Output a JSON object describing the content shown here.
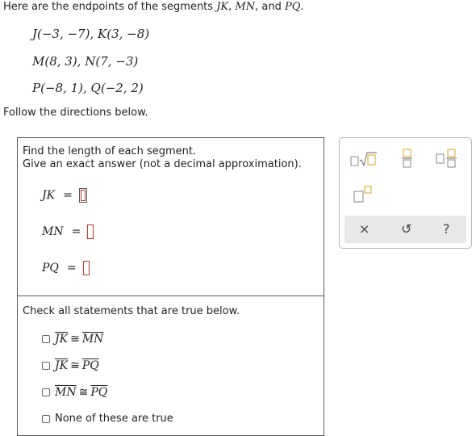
{
  "intro": {
    "text": "Here are the endpoints of the segments",
    "seg1": "JK",
    "comma": ",",
    "seg2": "MN",
    "and": ", and",
    "seg3": "PQ",
    "period": "."
  },
  "points": [
    "J(−3, −7), K(3, −8)",
    "M(8, 3), N(7, −3)",
    "P(−8, 1), Q(−2, 2)"
  ],
  "follow": "Follow the directions below.",
  "part1": {
    "line1": "Find the length of each segment.",
    "line2": "Give an exact answer (not a decimal approximation).",
    "answers": [
      {
        "segment": "JK",
        "eq": "="
      },
      {
        "segment": "MN",
        "eq": "="
      },
      {
        "segment": "PQ",
        "eq": "="
      }
    ]
  },
  "part2": {
    "instruction": "Check all statements that are true below.",
    "cong": "≅",
    "statements": [
      {
        "left": "JK",
        "right": "MN"
      },
      {
        "left": "JK",
        "right": "PQ"
      },
      {
        "left": "MN",
        "right": "PQ"
      }
    ],
    "none_label": "None of these are true"
  },
  "palette": {
    "tools": [
      "square-root-icon",
      "fraction-icon",
      "mixed-number-icon",
      "exponent-icon"
    ],
    "actions": {
      "clear": "×",
      "undo": "↺",
      "help": "?"
    }
  }
}
